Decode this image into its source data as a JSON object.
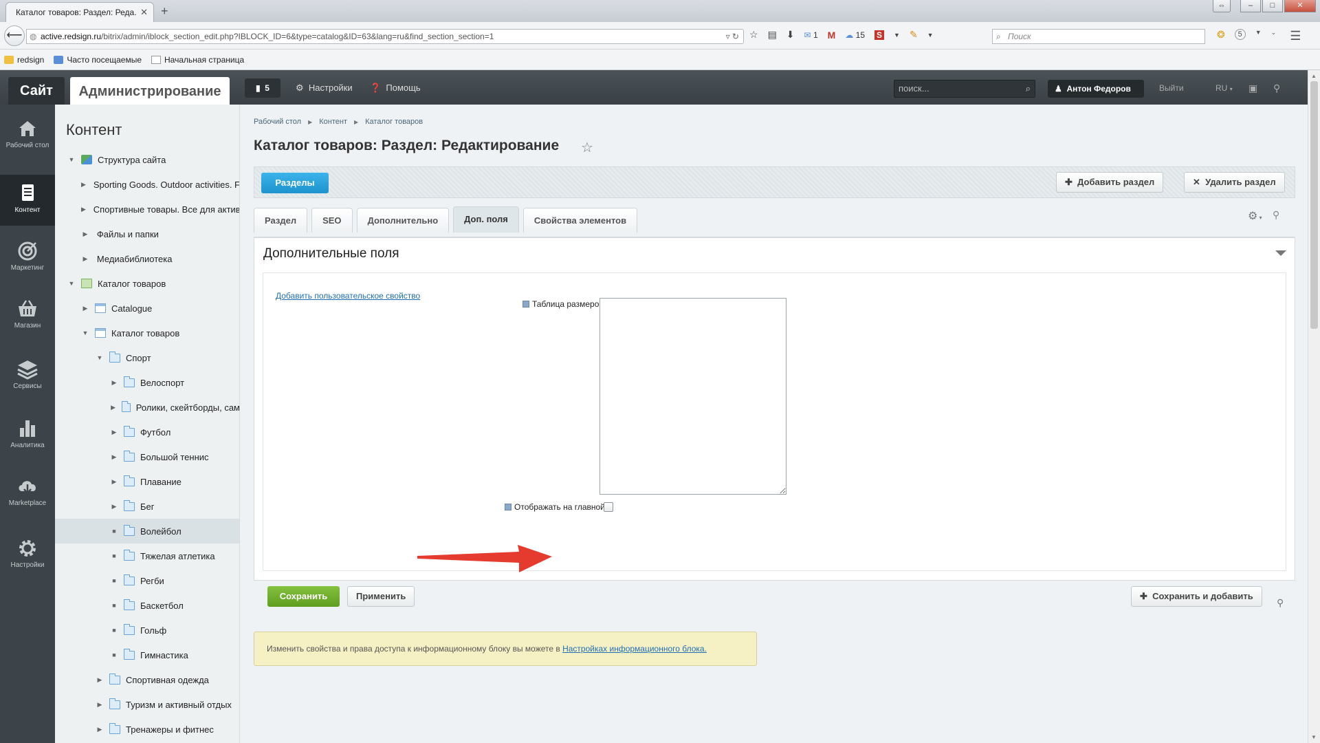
{
  "browser": {
    "tab_title": "Каталог товаров: Раздел: Реда...",
    "url_domain": "active.redsign.ru",
    "url_path": "/bitrix/admin/iblock_section_edit.php?IBLOCK_ID=6&type=catalog&ID=63&lang=ru&find_section_section=1",
    "mail_count": "1",
    "weather_count": "15",
    "search_placeholder": "Поиск",
    "badge_count": "5",
    "bookmarks": [
      "redsign",
      "Часто посещаемые",
      "Начальная страница"
    ]
  },
  "admin_panel": {
    "site_label": "Сайт",
    "admin_label": "Администрирование",
    "notifications_count": "5",
    "settings_label": "Настройки",
    "help_label": "Помощь",
    "search_placeholder": "поиск...",
    "user_name": "Антон Федоров",
    "logout_label": "Выйти",
    "lang_label": "RU"
  },
  "left_menu": [
    {
      "label": "Рабочий стол",
      "icon": "home-icon"
    },
    {
      "label": "Контент",
      "icon": "document-icon"
    },
    {
      "label": "Маркетинг",
      "icon": "target-icon"
    },
    {
      "label": "Магазин",
      "icon": "basket-icon"
    },
    {
      "label": "Сервисы",
      "icon": "layers-icon"
    },
    {
      "label": "Аналитика",
      "icon": "bar-chart-icon"
    },
    {
      "label": "Marketplace",
      "icon": "cloud-download-icon"
    },
    {
      "label": "Настройки",
      "icon": "gear-icon"
    }
  ],
  "tree": {
    "title": "Контент",
    "nodes": [
      "Структура сайта",
      "Sporting Goods. Outdoor activities. F",
      "Спортивные товары. Все для актив",
      "Файлы и папки",
      "Медиабиблиотека",
      "Каталог товаров",
      "Catalogue",
      "Каталог товаров",
      "Спорт",
      "Велоспорт",
      "Ролики, скейтборды, сам",
      "Футбол",
      "Большой теннис",
      "Плавание",
      "Бег",
      "Волейбол",
      "Тяжелая атлетика",
      "Регби",
      "Баскетбол",
      "Гольф",
      "Гимнастика",
      "Спортивная одежда",
      "Туризм и активный отдых",
      "Тренажеры и фитнес"
    ]
  },
  "main": {
    "breadcrumb": [
      "Рабочий стол",
      "Контент",
      "Каталог товаров"
    ],
    "title": "Каталог товаров: Раздел: Редактирование",
    "sections_button": "Разделы",
    "add_section_button": "Добавить раздел",
    "delete_section_button": "Удалить раздел",
    "tabs": [
      "Раздел",
      "SEO",
      "Дополнительно",
      "Доп. поля",
      "Свойства элементов"
    ],
    "active_tab": "Доп. поля",
    "panel_title": "Дополнительные поля",
    "add_property_link": "Добавить пользовательское свойство",
    "size_table_label": "Таблица размеров:",
    "show_on_main_label": "Отображать на главной:",
    "show_on_main_checked": false,
    "save_button": "Сохранить",
    "apply_button": "Применить",
    "save_add_button": "Сохранить и добавить",
    "notice_text": "Изменить свойства и права доступа к информационному блоку вы можете в ",
    "notice_link": "Настройках информационного блока."
  },
  "colors": {
    "admin_panel": "#3f464b",
    "left_menu": "#3c4449",
    "sections_button": "#2aa3dd",
    "save_button": "#6fae2a",
    "annotation_arrow": "#e53a2e"
  }
}
